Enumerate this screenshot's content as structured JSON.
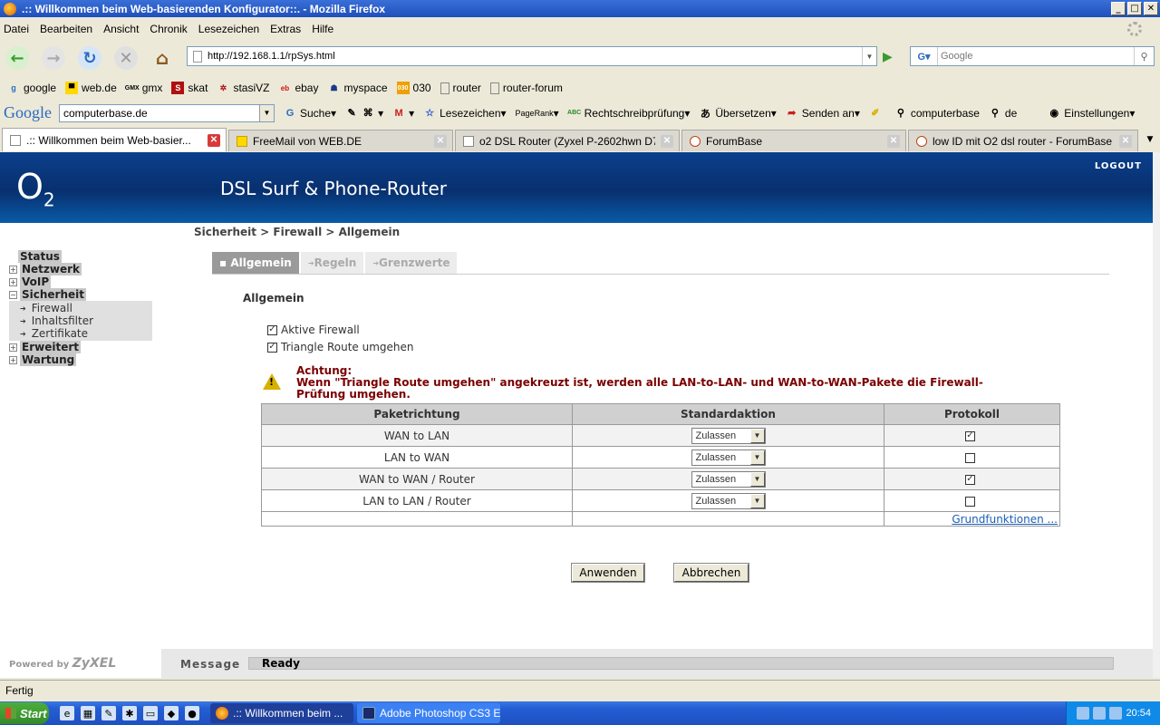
{
  "window": {
    "title": ".:: Willkommen beim Web-basierenden Konfigurator::. - Mozilla Firefox",
    "min": "_",
    "max": "□",
    "close": "✕"
  },
  "menubar": [
    "Datei",
    "Bearbeiten",
    "Ansicht",
    "Chronik",
    "Lesezeichen",
    "Extras",
    "Hilfe"
  ],
  "navbar": {
    "url": "http://192.168.1.1/rpSys.html",
    "search_placeholder": "Google"
  },
  "bookmarks": [
    {
      "label": "google",
      "icon": "google-icon"
    },
    {
      "label": "web.de",
      "icon": "webde-icon"
    },
    {
      "label": "gmx",
      "icon": "gmx-icon"
    },
    {
      "label": "skat",
      "icon": "skat-icon"
    },
    {
      "label": "stasiVZ",
      "icon": "stasivz-icon"
    },
    {
      "label": "ebay",
      "icon": "ebay-icon"
    },
    {
      "label": "myspace",
      "icon": "myspace-icon"
    },
    {
      "label": "030",
      "icon": "030-icon"
    },
    {
      "label": "router",
      "icon": "page-icon"
    },
    {
      "label": "router-forum",
      "icon": "page-icon"
    }
  ],
  "google_toolbar": {
    "logo": "Google",
    "query": "computerbase.de",
    "items": [
      "Suche",
      "Lesezeichen",
      "Rechtschreibprüfung",
      "Übersetzen",
      "Senden an",
      "computerbase",
      "de",
      "Einstellungen"
    ],
    "pagerank": "PageRank",
    "abc": "ABC"
  },
  "tabs": [
    {
      "label": ".:: Willkommen beim Web-basier...",
      "active": true
    },
    {
      "label": "FreeMail von WEB.DE",
      "active": false
    },
    {
      "label": "o2 DSL Router (Zyxel P-2602hwn D7A...",
      "active": false
    },
    {
      "label": "ForumBase",
      "active": false
    },
    {
      "label": "low ID mit O2 dsl router - ForumBase",
      "active": false
    }
  ],
  "page": {
    "brand": "O",
    "brand_sub": "2",
    "product": "DSL Surf & Phone-Router",
    "logout": "LOGOUT",
    "breadcrumb": "Sicherheit > Firewall > Allgemein",
    "sidemenu": {
      "status": "Status",
      "netzwerk": "Netzwerk",
      "voip": "VoIP",
      "sicherheit": "Sicherheit",
      "sub": [
        "Firewall",
        "Inhaltsfilter",
        "Zertifikate"
      ],
      "erweitert": "Erweitert",
      "wartung": "Wartung"
    },
    "subtabs": [
      "Allgemein",
      "Regeln",
      "Grenzwerte"
    ],
    "section_title": "Allgemein",
    "options": [
      {
        "label": "Aktive Firewall",
        "checked": true
      },
      {
        "label": "Triangle Route umgehen",
        "checked": true
      }
    ],
    "warning_title": "Achtung:",
    "warning_text": "Wenn \"Triangle Route umgehen\" angekreuzt ist, werden alle LAN-to-LAN- und WAN-to-WAN-Pakete die Firewall-Prüfung umgehen.",
    "table": {
      "headers": [
        "Paketrichtung",
        "Standardaktion",
        "Protokoll"
      ],
      "rows": [
        {
          "direction": "WAN to LAN",
          "action": "Zulassen",
          "log": true
        },
        {
          "direction": "LAN to WAN",
          "action": "Zulassen",
          "log": false
        },
        {
          "direction": "WAN to WAN / Router",
          "action": "Zulassen",
          "log": true
        },
        {
          "direction": "LAN to LAN / Router",
          "action": "Zulassen",
          "log": false
        }
      ],
      "link": "Grundfunktionen ..."
    },
    "apply_button": "Anwenden",
    "cancel_button": "Abbrechen",
    "powered_by": "Powered by",
    "powered_brand": "ZyXEL",
    "message_label": "Message",
    "message_value": "Ready"
  },
  "statusbar": "Fertig",
  "taskbar": {
    "start": "Start",
    "tasks": [
      {
        "label": ".:: Willkommen beim ...",
        "active": true
      },
      {
        "label": "Adobe Photoshop CS3 E...",
        "active": false
      }
    ],
    "clock": "20:54"
  },
  "colors": {
    "header_blue": "#08306e",
    "warning_red": "#7a0000",
    "taskbar_blue": "#245ed4",
    "link_blue": "#1a5fb4"
  }
}
